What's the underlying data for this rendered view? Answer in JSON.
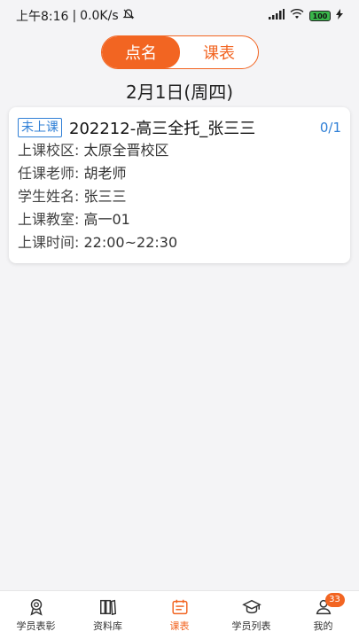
{
  "status_bar": {
    "time": "上午8:16",
    "speed": "0.0K/s",
    "battery": "100"
  },
  "segment": {
    "roll_call": "点名",
    "schedule": "课表"
  },
  "date_title": "2月1日(周四)",
  "card": {
    "tag": "未上课",
    "course_name": "202212-高三全托_张三三",
    "count": "0/1",
    "rows": [
      {
        "label": "上课校区:",
        "value": "太原全晋校区"
      },
      {
        "label": "任课老师:",
        "value": "胡老师"
      },
      {
        "label": "学生姓名:",
        "value": "张三三"
      },
      {
        "label": "上课教室:",
        "value": "高一01"
      },
      {
        "label": "上课时间:",
        "value": "22:00~22:30"
      }
    ]
  },
  "tabs": [
    {
      "label": "学员表彰"
    },
    {
      "label": "资料库"
    },
    {
      "label": "课表"
    },
    {
      "label": "学员列表"
    },
    {
      "label": "我的",
      "badge": "33"
    }
  ],
  "colors": {
    "accent": "#f26522",
    "link": "#2f7fd6"
  }
}
